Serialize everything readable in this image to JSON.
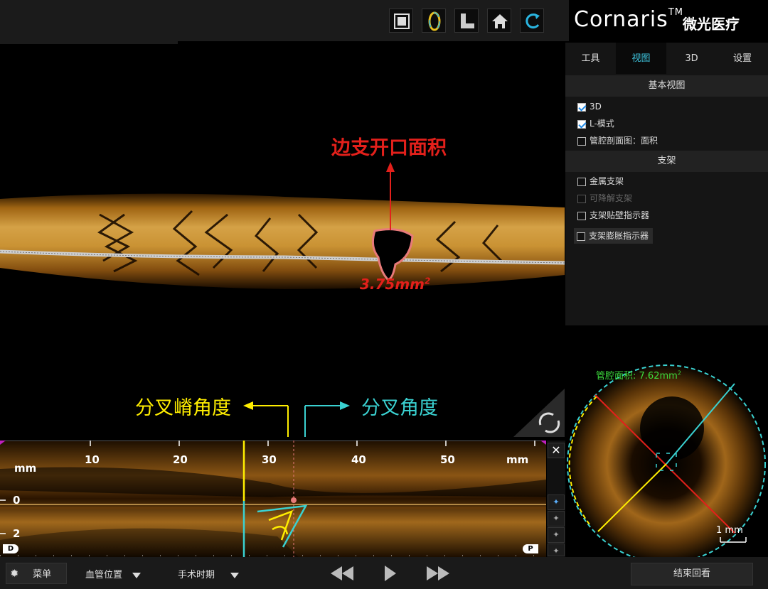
{
  "toolbar": {
    "buttons": [
      {
        "name": "fullscreen-icon"
      },
      {
        "name": "ring-icon"
      },
      {
        "name": "foot-icon"
      },
      {
        "name": "home-icon"
      },
      {
        "name": "rotate-icon"
      }
    ]
  },
  "logo": {
    "brand": "Cornaris",
    "tm": "TM",
    "cn": "微光医疗"
  },
  "right_panel": {
    "tabs": [
      {
        "label": "工具",
        "active": false
      },
      {
        "label": "视图",
        "active": true
      },
      {
        "label": "3D",
        "active": false
      },
      {
        "label": "设置",
        "active": false
      }
    ],
    "section_basic": "基本视图",
    "basic_options": [
      {
        "label": "3D",
        "checked": true
      },
      {
        "label": "L-模式",
        "checked": true
      },
      {
        "label": "管腔剖面图：面积",
        "checked": false
      }
    ],
    "section_stent": "支架",
    "stent_options": [
      {
        "label": "金属支架",
        "checked": false,
        "enabled": true
      },
      {
        "label": "可降解支架",
        "checked": false,
        "enabled": false
      },
      {
        "label": "支架贴壁指示器",
        "checked": false,
        "enabled": true
      },
      {
        "label": "支架膨胀指示器",
        "checked": false,
        "enabled": true
      }
    ]
  },
  "annotations": {
    "side_branch_area_title": "边支开口面积",
    "side_branch_area_value": "3.75mm",
    "side_branch_area_sup": "2",
    "bifurcation_ridge_angle": "分叉嵴角度",
    "bifurcation_angle": "分叉角度",
    "colors": {
      "red": "#e3201b",
      "yellow": "#ffee00",
      "cyan": "#3ad1d1"
    }
  },
  "lmode": {
    "unit_left": "mm",
    "unit_right": "mm",
    "ticks": [
      "10",
      "20",
      "30",
      "40",
      "50"
    ],
    "depth_labels": [
      "0",
      "2"
    ],
    "marker_distal": "D",
    "marker_proximal": "P"
  },
  "cross_section": {
    "lumen_area_label": "管腔面积:",
    "lumen_area_value": "7.62mm",
    "lumen_area_sup": "2",
    "scale": "1 mm"
  },
  "bottom_bar": {
    "menu_label": "菜单",
    "vessel_position": "血管位置",
    "surgery_period": "手术时期",
    "end_review": "结束回看"
  }
}
